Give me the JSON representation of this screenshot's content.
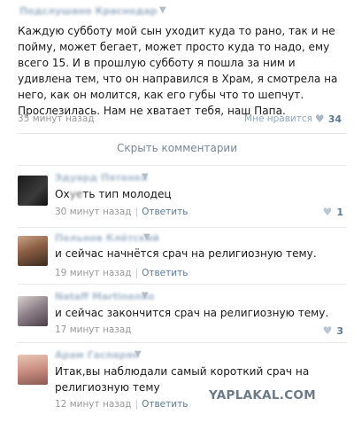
{
  "post": {
    "author": "Подслушано Краснодар",
    "text": "Каждую субботу мой сын уходит куда то рано, так и не пойму, может бегает, может просто куда то надо, ему всего 15. И в прошлую субботу я пошла за ним и удивлена тем, что он направился в Храм, я смотрела на него, как он молится, как его губы что то шепчут. Прослезилась. Нам не хватает тебя, наш Папа.",
    "time": "35 минут назад",
    "like_label": "Мне нравится",
    "like_count": "34"
  },
  "hide_comments_label": "Скрыть комментарии",
  "comments": [
    {
      "author": "Эдуард Пятенко",
      "text_prefix": "Ох",
      "text_censored": "уе",
      "text_suffix": "ть тип молодец",
      "time": "30 минут назад",
      "reply": "Ответить",
      "likes": "1"
    },
    {
      "author": "Пельнов Клётский",
      "text": "и сейчас начнётся срач на религиозную тему.",
      "time": "19 минут назад",
      "reply": "Ответить",
      "likes": ""
    },
    {
      "author": "Nataff Martinenko",
      "text": "и сейчас закончится срач на религиозную тему.",
      "time": "17 минут назад",
      "reply": "",
      "likes": "3"
    },
    {
      "author": "Арам Гаспарян",
      "text": "Итак,вы наблюдали самый короткий срач на религиозную тему",
      "time": "12 минут назад",
      "reply": "Ответить",
      "likes": ""
    }
  ],
  "watermark": "YAPLAKAL.COM",
  "colors": {
    "link": "#5b7a9a",
    "muted": "#999999",
    "divider": "#e6e9ec"
  }
}
